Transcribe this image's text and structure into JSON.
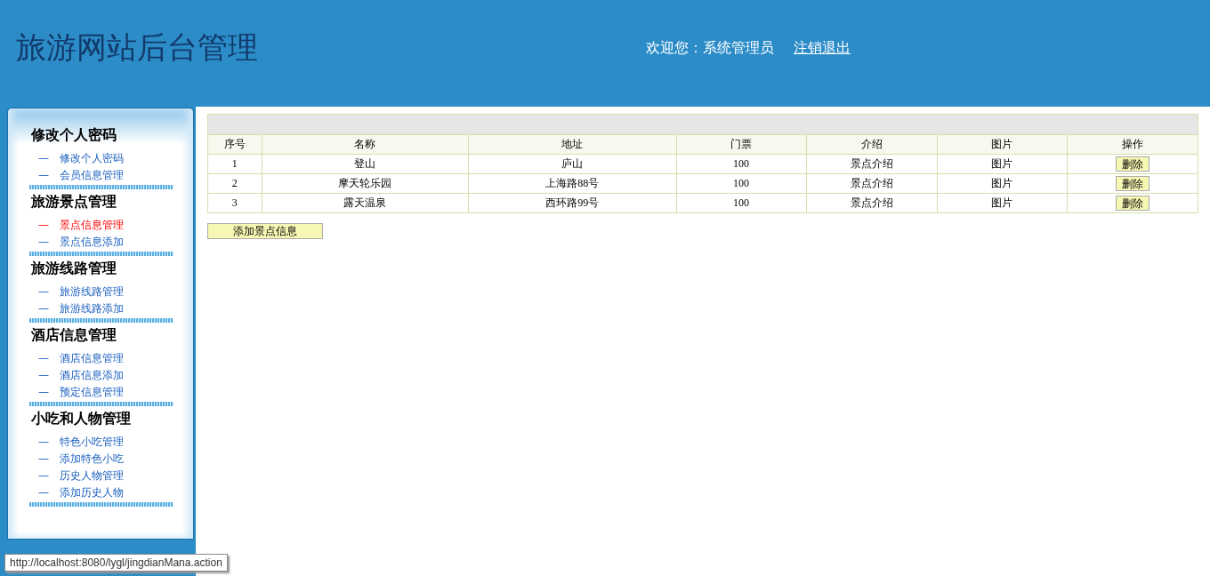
{
  "header": {
    "title": "旅游网站后台管理",
    "welcome": "欢迎您：系统管理员",
    "logout": "注销退出"
  },
  "sidebar": {
    "groups": [
      {
        "title": "修改个人密码",
        "items": [
          {
            "marker": "—",
            "label": "修改个人密码",
            "selected": false
          },
          {
            "marker": "—",
            "label": "会员信息管理",
            "selected": false
          }
        ]
      },
      {
        "title": "旅游景点管理",
        "items": [
          {
            "marker": "—",
            "label": "景点信息管理",
            "selected": true
          },
          {
            "marker": "—",
            "label": "景点信息添加",
            "selected": false
          }
        ]
      },
      {
        "title": "旅游线路管理",
        "items": [
          {
            "marker": "—",
            "label": "旅游线路管理",
            "selected": false
          },
          {
            "marker": "—",
            "label": "旅游线路添加",
            "selected": false
          }
        ]
      },
      {
        "title": "酒店信息管理",
        "items": [
          {
            "marker": "—",
            "label": "酒店信息管理",
            "selected": false
          },
          {
            "marker": "—",
            "label": "酒店信息添加",
            "selected": false
          },
          {
            "marker": "—",
            "label": "预定信息管理",
            "selected": false
          }
        ]
      },
      {
        "title": "小吃和人物管理",
        "items": [
          {
            "marker": "—",
            "label": "特色小吃管理",
            "selected": false
          },
          {
            "marker": "—",
            "label": "添加特色小吃",
            "selected": false
          },
          {
            "marker": "—",
            "label": "历史人物管理",
            "selected": false
          },
          {
            "marker": "—",
            "label": "添加历史人物",
            "selected": false
          }
        ]
      }
    ]
  },
  "table": {
    "columns": [
      "序号",
      "名称",
      "地址",
      "门票",
      "介绍",
      "图片",
      "操作"
    ],
    "rows": [
      {
        "cells": [
          "1",
          "登山",
          "庐山",
          "100",
          "景点介绍",
          "图片"
        ],
        "action": "删除"
      },
      {
        "cells": [
          "2",
          "摩天轮乐园",
          "上海路88号",
          "100",
          "景点介绍",
          "图片"
        ],
        "action": "删除"
      },
      {
        "cells": [
          "3",
          "露天温泉",
          "西环路99号",
          "100",
          "景点介绍",
          "图片"
        ],
        "action": "删除"
      }
    ]
  },
  "add_button": "添加景点信息",
  "status_bar": "http://localhost:8080/lygl/jingdianMana.action"
}
